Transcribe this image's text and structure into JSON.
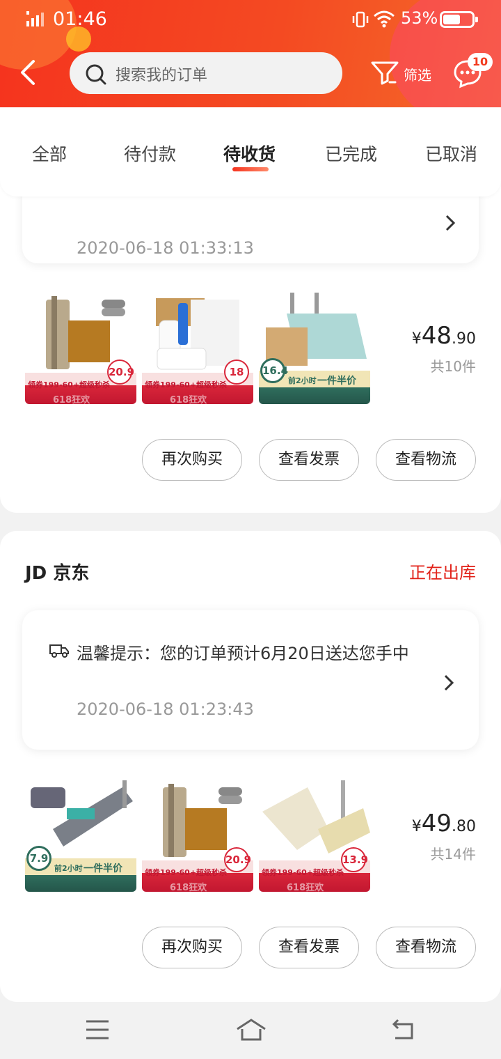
{
  "status_bar": {
    "time": "01:46",
    "battery": "53%"
  },
  "header": {
    "search_placeholder": "搜索我的订单",
    "filter_label": "筛选",
    "message_badge": "10"
  },
  "tabs": [
    {
      "label": "全部",
      "active": false
    },
    {
      "label": "待付款",
      "active": false
    },
    {
      "label": "待收货",
      "active": true
    },
    {
      "label": "已完成",
      "active": false
    },
    {
      "label": "已取消",
      "active": false
    }
  ],
  "orders": [
    {
      "notice_time": "2020-06-18 01:33:13",
      "items": [
        {
          "promo": "领券199-60+超级秒杀",
          "sub": "618狂欢",
          "badge": "20.9"
        },
        {
          "promo": "领券199-60+超级秒杀",
          "sub": "618狂欢",
          "badge": "18"
        },
        {
          "promo": "一件半价",
          "sub": "前2小时",
          "badge": "16.4"
        }
      ],
      "price_symbol": "¥",
      "price_int": "48",
      "price_dec": ".90",
      "count": "共10件",
      "buttons": [
        "再次购买",
        "查看发票",
        "查看物流"
      ]
    },
    {
      "store": "京东",
      "store_logo": "JD",
      "status": "正在出库",
      "notice_text": "温馨提示：您的订单预计6月20日送达您手中",
      "notice_time": "2020-06-18 01:23:43",
      "items": [
        {
          "promo": "一件半价",
          "sub": "前2小时",
          "badge": "7.9"
        },
        {
          "promo": "领券199-60+超级秒杀",
          "sub": "618狂欢",
          "badge": "20.9"
        },
        {
          "promo": "领券199-60+超级秒杀",
          "sub": "618狂欢",
          "badge": "13.9"
        }
      ],
      "price_symbol": "¥",
      "price_int": "49",
      "price_dec": ".80",
      "count": "共14件",
      "buttons": [
        "再次购买",
        "查看发票",
        "查看物流"
      ]
    }
  ],
  "colors": {
    "brand_red": "#f5331e",
    "status_red": "#e2231a"
  },
  "icons": [
    "signal-icon",
    "vibrate-icon",
    "wifi-icon",
    "battery-icon",
    "back-icon",
    "search-icon",
    "filter-icon",
    "message-icon",
    "truck-icon",
    "chevron-right-icon",
    "menu-icon",
    "home-icon",
    "back-nav-icon"
  ]
}
